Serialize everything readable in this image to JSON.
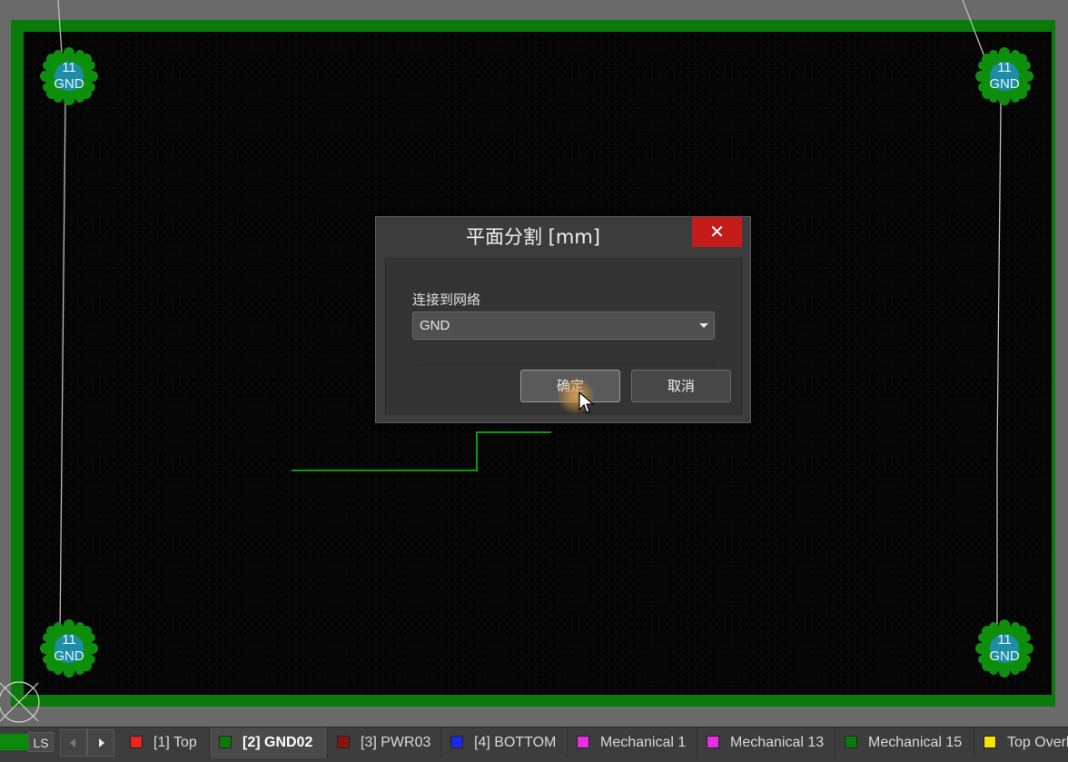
{
  "dialog": {
    "title": "平面分割 [mm]",
    "close_label": "✕",
    "net_label": "连接到网络",
    "net_value": "GND",
    "ok_label": "确定",
    "cancel_label": "取消"
  },
  "pads": [
    {
      "number": "11",
      "net": "GND"
    },
    {
      "number": "11",
      "net": "GND"
    },
    {
      "number": "11",
      "net": "GND"
    },
    {
      "number": "11",
      "net": "GND"
    }
  ],
  "colors": {
    "board_outline": "#0a7a0a",
    "pad_ring": "#0d8f0d",
    "pad_core": "#1e8ea6",
    "trace": "#0d9a0d",
    "close_button": "#c41b1b"
  },
  "layer_bar": {
    "ls_label": "LS",
    "prev_icon": "chevron-left-icon",
    "next_icon": "chevron-right-icon",
    "tabs": [
      {
        "label": "[1] Top",
        "color": "#e8251e",
        "active": false
      },
      {
        "label": "[2] GND02",
        "color": "#0b7a0b",
        "active": true
      },
      {
        "label": "[3] PWR03",
        "color": "#8a1414",
        "active": false
      },
      {
        "label": "[4] BOTTOM",
        "color": "#1a2ae6",
        "active": false
      },
      {
        "label": "Mechanical 1",
        "color": "#e62ee6",
        "active": false
      },
      {
        "label": "Mechanical 13",
        "color": "#e62ee6",
        "active": false
      },
      {
        "label": "Mechanical 15",
        "color": "#0b7a0b",
        "active": false
      },
      {
        "label": "Top Overlay",
        "color": "#f2e600",
        "active": false
      }
    ]
  }
}
